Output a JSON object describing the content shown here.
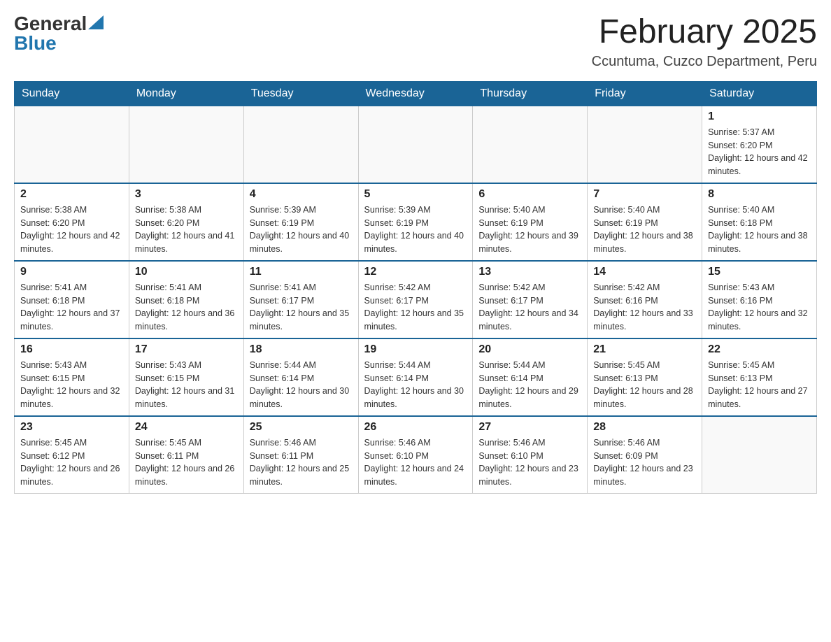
{
  "header": {
    "logo_general": "General",
    "logo_blue": "Blue",
    "month_title": "February 2025",
    "location": "Ccuntuma, Cuzco Department, Peru"
  },
  "weekdays": [
    "Sunday",
    "Monday",
    "Tuesday",
    "Wednesday",
    "Thursday",
    "Friday",
    "Saturday"
  ],
  "weeks": [
    [
      {
        "day": "",
        "info": ""
      },
      {
        "day": "",
        "info": ""
      },
      {
        "day": "",
        "info": ""
      },
      {
        "day": "",
        "info": ""
      },
      {
        "day": "",
        "info": ""
      },
      {
        "day": "",
        "info": ""
      },
      {
        "day": "1",
        "info": "Sunrise: 5:37 AM\nSunset: 6:20 PM\nDaylight: 12 hours and 42 minutes."
      }
    ],
    [
      {
        "day": "2",
        "info": "Sunrise: 5:38 AM\nSunset: 6:20 PM\nDaylight: 12 hours and 42 minutes."
      },
      {
        "day": "3",
        "info": "Sunrise: 5:38 AM\nSunset: 6:20 PM\nDaylight: 12 hours and 41 minutes."
      },
      {
        "day": "4",
        "info": "Sunrise: 5:39 AM\nSunset: 6:19 PM\nDaylight: 12 hours and 40 minutes."
      },
      {
        "day": "5",
        "info": "Sunrise: 5:39 AM\nSunset: 6:19 PM\nDaylight: 12 hours and 40 minutes."
      },
      {
        "day": "6",
        "info": "Sunrise: 5:40 AM\nSunset: 6:19 PM\nDaylight: 12 hours and 39 minutes."
      },
      {
        "day": "7",
        "info": "Sunrise: 5:40 AM\nSunset: 6:19 PM\nDaylight: 12 hours and 38 minutes."
      },
      {
        "day": "8",
        "info": "Sunrise: 5:40 AM\nSunset: 6:18 PM\nDaylight: 12 hours and 38 minutes."
      }
    ],
    [
      {
        "day": "9",
        "info": "Sunrise: 5:41 AM\nSunset: 6:18 PM\nDaylight: 12 hours and 37 minutes."
      },
      {
        "day": "10",
        "info": "Sunrise: 5:41 AM\nSunset: 6:18 PM\nDaylight: 12 hours and 36 minutes."
      },
      {
        "day": "11",
        "info": "Sunrise: 5:41 AM\nSunset: 6:17 PM\nDaylight: 12 hours and 35 minutes."
      },
      {
        "day": "12",
        "info": "Sunrise: 5:42 AM\nSunset: 6:17 PM\nDaylight: 12 hours and 35 minutes."
      },
      {
        "day": "13",
        "info": "Sunrise: 5:42 AM\nSunset: 6:17 PM\nDaylight: 12 hours and 34 minutes."
      },
      {
        "day": "14",
        "info": "Sunrise: 5:42 AM\nSunset: 6:16 PM\nDaylight: 12 hours and 33 minutes."
      },
      {
        "day": "15",
        "info": "Sunrise: 5:43 AM\nSunset: 6:16 PM\nDaylight: 12 hours and 32 minutes."
      }
    ],
    [
      {
        "day": "16",
        "info": "Sunrise: 5:43 AM\nSunset: 6:15 PM\nDaylight: 12 hours and 32 minutes."
      },
      {
        "day": "17",
        "info": "Sunrise: 5:43 AM\nSunset: 6:15 PM\nDaylight: 12 hours and 31 minutes."
      },
      {
        "day": "18",
        "info": "Sunrise: 5:44 AM\nSunset: 6:14 PM\nDaylight: 12 hours and 30 minutes."
      },
      {
        "day": "19",
        "info": "Sunrise: 5:44 AM\nSunset: 6:14 PM\nDaylight: 12 hours and 30 minutes."
      },
      {
        "day": "20",
        "info": "Sunrise: 5:44 AM\nSunset: 6:14 PM\nDaylight: 12 hours and 29 minutes."
      },
      {
        "day": "21",
        "info": "Sunrise: 5:45 AM\nSunset: 6:13 PM\nDaylight: 12 hours and 28 minutes."
      },
      {
        "day": "22",
        "info": "Sunrise: 5:45 AM\nSunset: 6:13 PM\nDaylight: 12 hours and 27 minutes."
      }
    ],
    [
      {
        "day": "23",
        "info": "Sunrise: 5:45 AM\nSunset: 6:12 PM\nDaylight: 12 hours and 26 minutes."
      },
      {
        "day": "24",
        "info": "Sunrise: 5:45 AM\nSunset: 6:11 PM\nDaylight: 12 hours and 26 minutes."
      },
      {
        "day": "25",
        "info": "Sunrise: 5:46 AM\nSunset: 6:11 PM\nDaylight: 12 hours and 25 minutes."
      },
      {
        "day": "26",
        "info": "Sunrise: 5:46 AM\nSunset: 6:10 PM\nDaylight: 12 hours and 24 minutes."
      },
      {
        "day": "27",
        "info": "Sunrise: 5:46 AM\nSunset: 6:10 PM\nDaylight: 12 hours and 23 minutes."
      },
      {
        "day": "28",
        "info": "Sunrise: 5:46 AM\nSunset: 6:09 PM\nDaylight: 12 hours and 23 minutes."
      },
      {
        "day": "",
        "info": ""
      }
    ]
  ]
}
